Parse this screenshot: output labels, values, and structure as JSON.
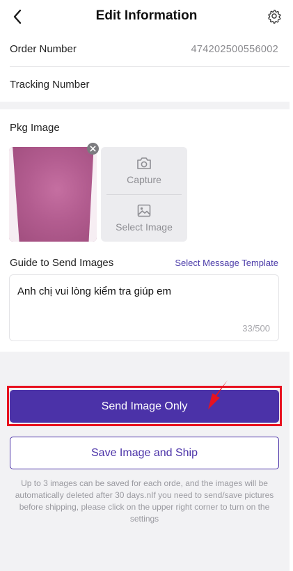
{
  "header": {
    "title": "Edit Information",
    "back_icon": "chevron-left-icon",
    "settings_icon": "gear-icon"
  },
  "order": {
    "order_label": "Order Number",
    "order_value": "474202500556002",
    "tracking_label": "Tracking Number"
  },
  "package": {
    "image_label": "Pkg Image",
    "capture_label": "Capture",
    "select_label": "Select Image"
  },
  "guide": {
    "label": "Guide to Send Images",
    "template_link": "Select Message Template",
    "message": "Anh chị vui lòng kiểm tra giúp em",
    "count": "33/500"
  },
  "actions": {
    "send_label": "Send Image Only",
    "save_label": "Save Image and Ship"
  },
  "note": "Up to 3 images can be saved for each orde, and the images will be automatically deleted after 30 days.nIf you need to send/save pictures before shipping, please click on the upper right corner to turn on the settings",
  "colors": {
    "primary": "#4b32a8",
    "highlight": "#e8121f"
  }
}
